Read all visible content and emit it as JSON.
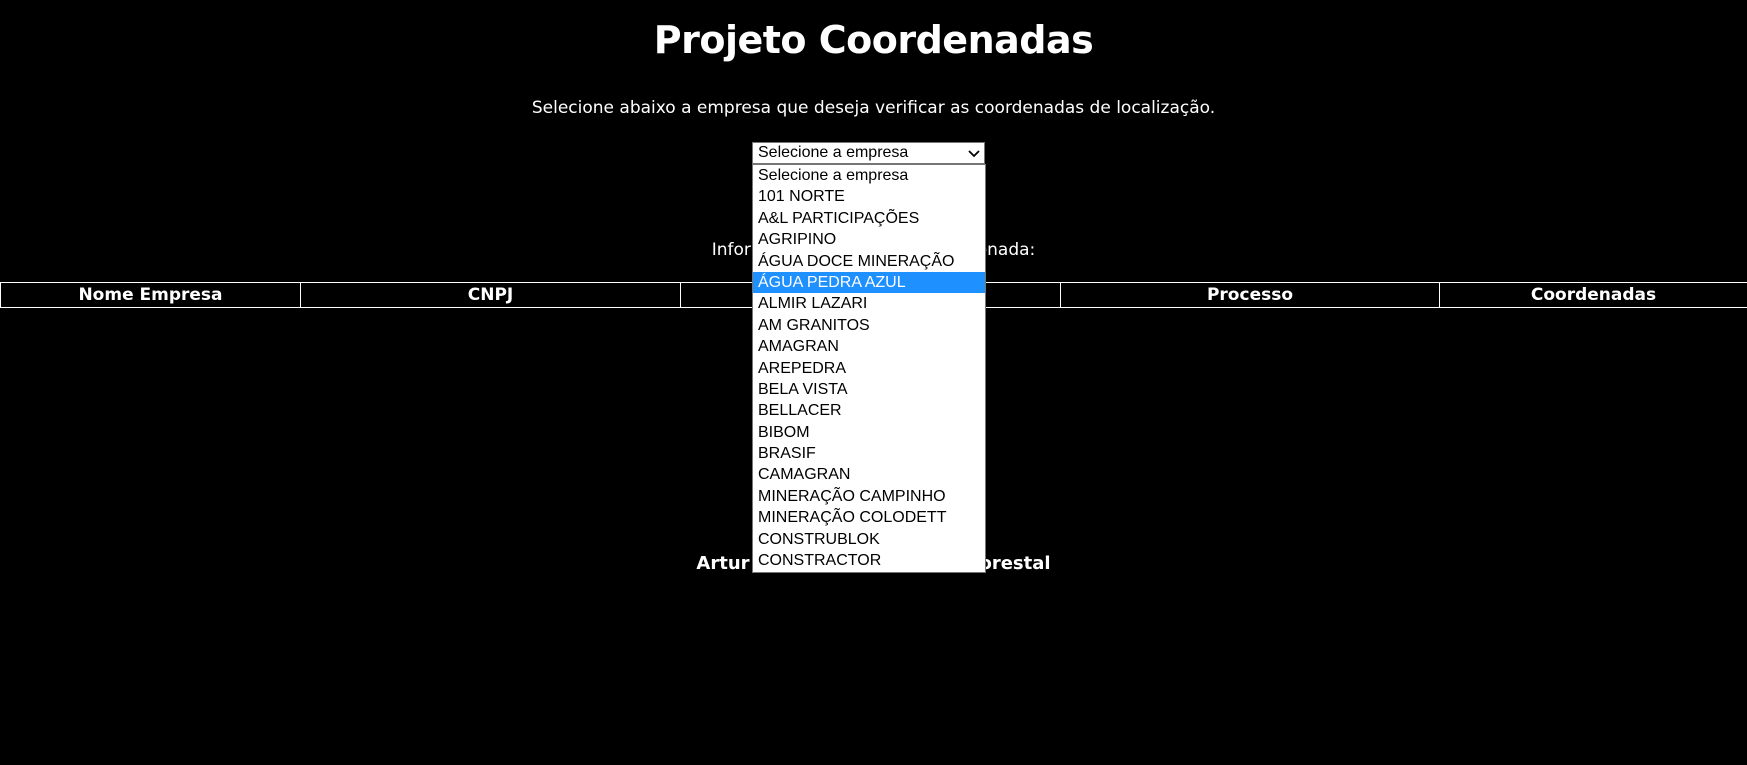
{
  "page": {
    "title": "Projeto Coordenadas",
    "subtitle": "Selecione abaixo a empresa que deseja verificar as coordenadas de localização.",
    "info_label": "Informações da empresa selecionada:",
    "footer": "Artur Cunha - Engenharia Florestal"
  },
  "select": {
    "value": "Selecione a empresa",
    "chevron": "chevron-down-icon",
    "options": [
      "Selecione a empresa",
      "101 NORTE",
      "A&L PARTICIPAÇÕES",
      "AGRIPINO",
      "ÁGUA DOCE MINERAÇÃO",
      "ÁGUA PEDRA AZUL",
      "ALMIR LAZARI",
      "AM GRANITOS",
      "AMAGRAN",
      "AREPEDRA",
      "BELA VISTA",
      "BELLACER",
      "BIBOM",
      "BRASIF",
      "CAMAGRAN",
      "MINERAÇÃO CAMPINHO",
      "MINERAÇÃO COLODETT",
      "CONSTRUBLOK",
      "CONSTRACTOR"
    ],
    "highlighted_index": 5
  },
  "table": {
    "headers": [
      "Nome Empresa",
      "CNPJ",
      "",
      "Processo",
      "Coordenadas"
    ]
  },
  "colors": {
    "background": "#000000",
    "text": "#ffffff",
    "highlight": "#1e90ff"
  }
}
